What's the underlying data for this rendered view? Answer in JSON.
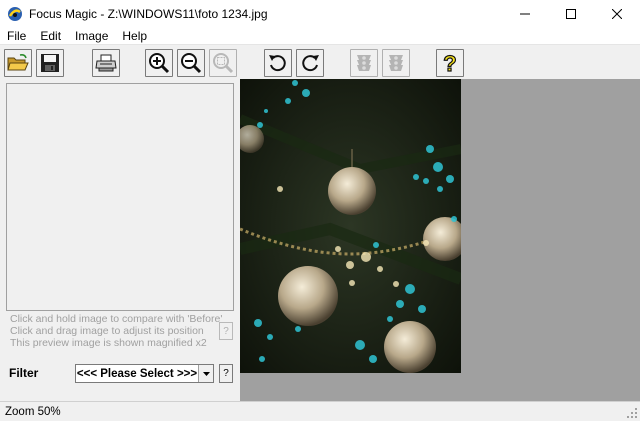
{
  "window": {
    "title": "Focus Magic - Z:\\WINDOWS11\\foto 1234.jpg",
    "controls": [
      "minimize",
      "maximize",
      "close"
    ]
  },
  "menu": {
    "items": [
      {
        "label": "File"
      },
      {
        "label": "Edit"
      },
      {
        "label": "Image"
      },
      {
        "label": "Help"
      }
    ]
  },
  "toolbar": {
    "buttons": [
      {
        "icon": "open-folder-icon",
        "enabled": true
      },
      {
        "icon": "save-disk-icon",
        "enabled": true
      },
      {
        "icon": "print-icon",
        "enabled": true
      },
      {
        "icon": "zoom-in-icon",
        "enabled": true
      },
      {
        "icon": "zoom-out-icon",
        "enabled": true
      },
      {
        "icon": "zoom-fit-icon",
        "enabled": false
      },
      {
        "icon": "undo-icon",
        "enabled": true
      },
      {
        "icon": "redo-icon",
        "enabled": true
      },
      {
        "icon": "traffic-light-icon",
        "enabled": false
      },
      {
        "icon": "traffic-light-icon",
        "enabled": false
      },
      {
        "icon": "help-question-icon",
        "enabled": true
      }
    ]
  },
  "preview": {
    "hints": [
      "Click and hold image to compare with 'Before'",
      "Click and drag image to adjust its position",
      "This preview image is shown magnified x2"
    ],
    "help_label": "?"
  },
  "filter": {
    "label": "Filter",
    "selected": "<<< Please Select >>>",
    "help_label": "?"
  },
  "status": {
    "text": "Zoom 50%"
  },
  "colors": {
    "canvas_bg": "#a0a0a0",
    "panel_bg": "#f0f0f0",
    "hint_text": "#a0a0a0"
  }
}
